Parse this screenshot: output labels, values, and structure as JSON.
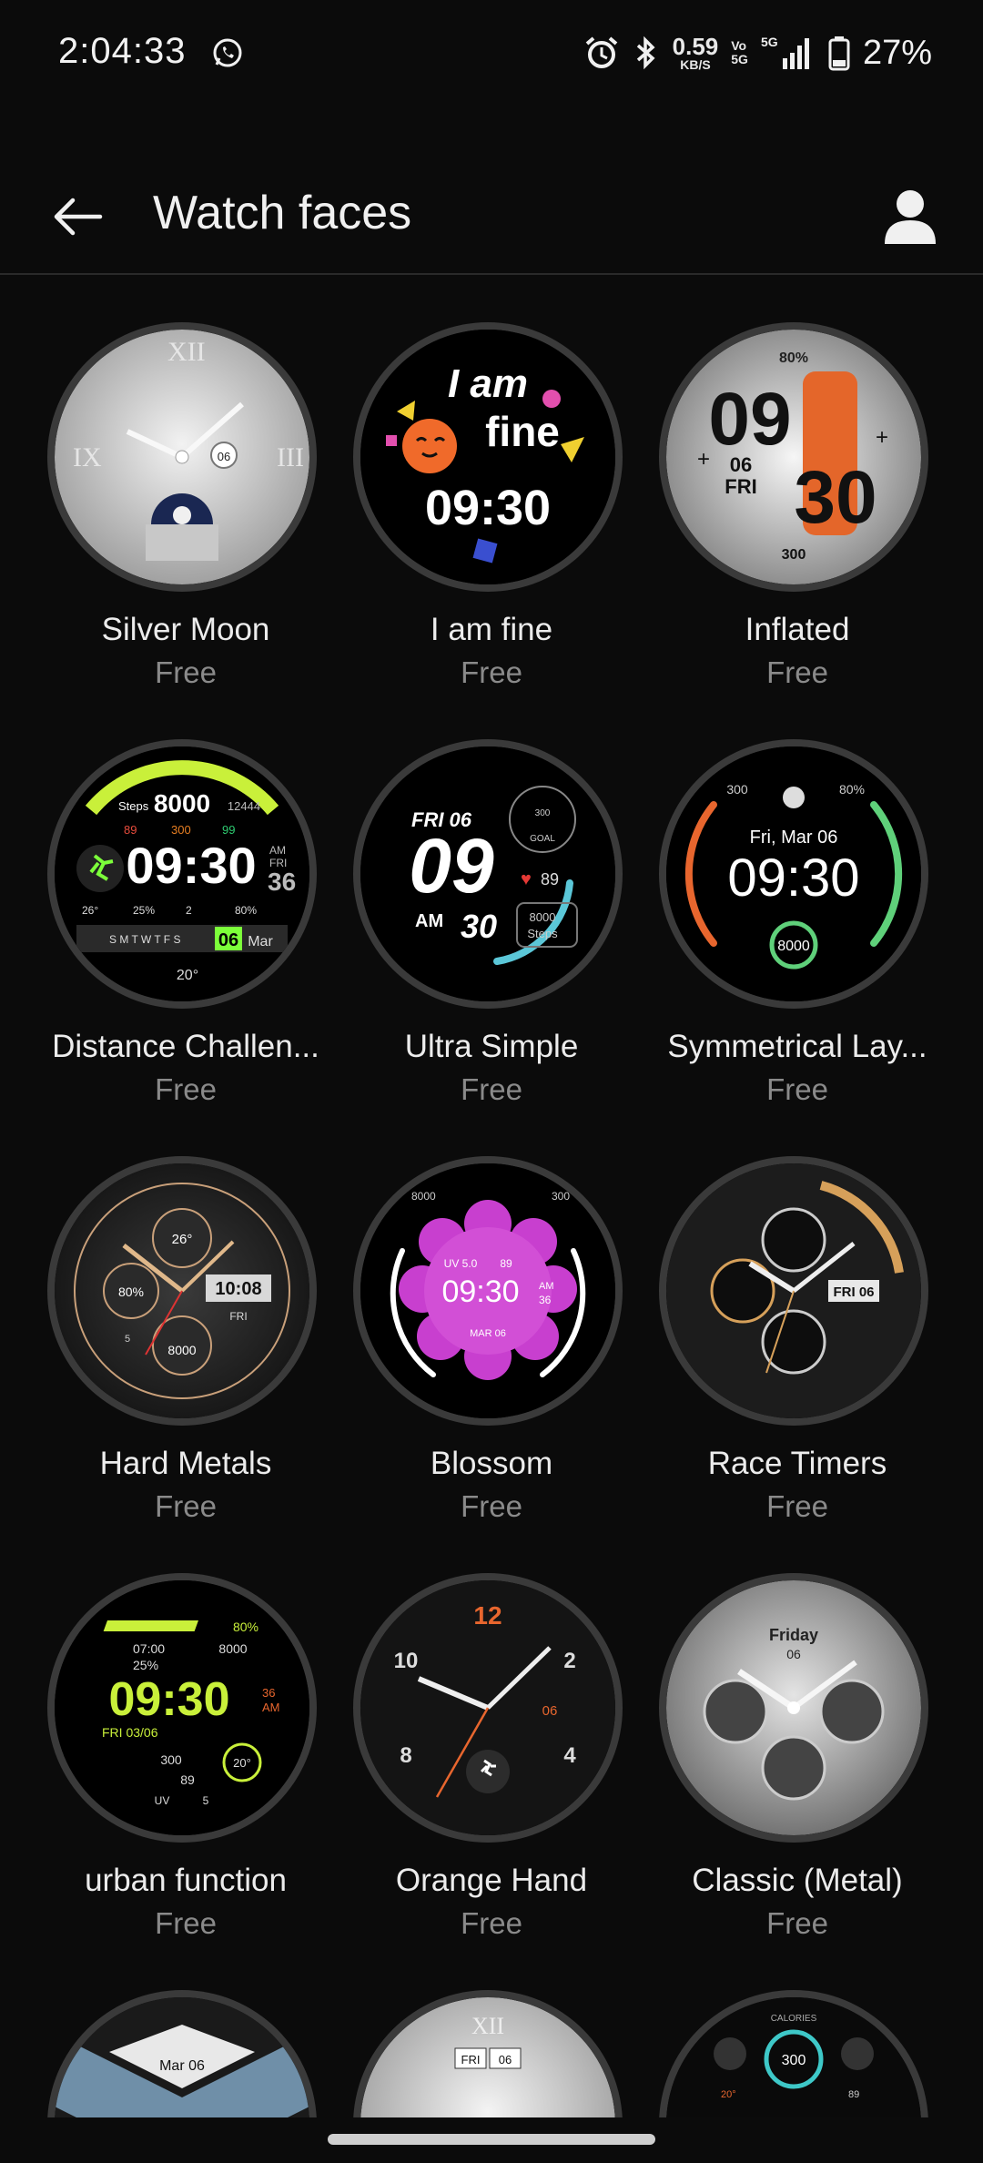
{
  "status_bar": {
    "time": "2:04:33",
    "net_speed_value": "0.59",
    "net_speed_unit": "KB/S",
    "volte_top": "Vo",
    "volte_bottom": "5G",
    "network_type": "5G",
    "battery": "27%",
    "icons": [
      "whatsapp-icon",
      "alarm-icon",
      "bluetooth-icon",
      "signal-icon",
      "battery-icon"
    ]
  },
  "header": {
    "title": "Watch faces",
    "back_icon": "arrow-left-icon",
    "profile_icon": "person-icon"
  },
  "watch_faces": [
    {
      "name": "Silver Moon",
      "price": "Free"
    },
    {
      "name": "I am fine",
      "price": "Free"
    },
    {
      "name": "Inflated",
      "price": "Free"
    },
    {
      "name": "Distance Challen...",
      "price": "Free"
    },
    {
      "name": "Ultra Simple",
      "price": "Free"
    },
    {
      "name": "Symmetrical Lay...",
      "price": "Free"
    },
    {
      "name": "Hard Metals",
      "price": "Free"
    },
    {
      "name": "Blossom",
      "price": "Free"
    },
    {
      "name": "Race Timers",
      "price": "Free"
    },
    {
      "name": "urban function",
      "price": "Free"
    },
    {
      "name": "Orange Hand",
      "price": "Free"
    },
    {
      "name": "Classic (Metal)",
      "price": "Free"
    },
    {
      "name": "",
      "price": ""
    },
    {
      "name": "",
      "price": ""
    },
    {
      "name": "",
      "price": ""
    }
  ],
  "face_text": {
    "silver_moon": {
      "date": "06"
    },
    "i_am_fine": {
      "line1": "I am",
      "line2": "fine",
      "time": "09:30"
    },
    "inflated": {
      "battery": "80%",
      "hour": "09",
      "minute": "30",
      "day": "06",
      "weekday": "FRI",
      "steps": "300"
    },
    "distance": {
      "steps_label": "Steps",
      "steps": "8000",
      "steps_goal": "12444",
      "hr": "89",
      "kcal": "300",
      "spo": "99",
      "time": "09:30",
      "ampm": "AM",
      "weekday": "FRI",
      "sec": "36",
      "weather": "26°",
      "humidity": "25%",
      "floors": "2",
      "battery": "80%",
      "days": "S M T W T F S",
      "date": "06",
      "month": "Mar",
      "temp": "20°"
    },
    "ultra_simple": {
      "date": "FRI 06",
      "hour": "09",
      "ampm": "AM",
      "minute": "30",
      "hr": "89",
      "steps": "8000",
      "steps_label": "Steps",
      "goal": "GOAL",
      "top": "300"
    },
    "symmetrical": {
      "left_top": "300",
      "right_top": "80%",
      "date": "Fri, Mar 06",
      "time": "09:30",
      "steps": "8000"
    },
    "hard_metals": {
      "temp": "26°",
      "battery": "80%",
      "time": "10:08",
      "weekday": "FRI",
      "steps": "8000",
      "uv": "5"
    },
    "blossom": {
      "steps": "8000",
      "kcal": "300",
      "uv": "UV 5.0",
      "hr": "89",
      "time": "09:30",
      "ampm": "AM",
      "sec": "36",
      "date": "MAR 06"
    },
    "race_timers": {
      "date": "FRI 06"
    },
    "urban_function": {
      "battery": "80%",
      "time_small": "07:00",
      "steps": "8000",
      "humidity": "25%",
      "time": "09:30",
      "sec": "36",
      "ampm": "AM",
      "date": "FRI 03/06",
      "kcal": "300",
      "temp": "20°",
      "hr": "89",
      "uv_label": "UV",
      "uv": "5"
    },
    "orange_hand": {
      "n12": "12",
      "n2": "2",
      "n4": "4",
      "n8": "8",
      "n10": "10",
      "date": "06"
    },
    "classic_metal": {
      "weekday": "Friday",
      "date": "06"
    },
    "partial_1": {
      "date": "Mar 06"
    },
    "partial_2": {
      "weekday": "FRI",
      "date": "06"
    },
    "partial_3": {
      "label": "CALORIES",
      "value": "300",
      "temp": "20°",
      "hr": "89"
    }
  },
  "colors": {
    "background": "#0b0b0b",
    "accent_orange": "#e8662e",
    "accent_green": "#5fd07a",
    "accent_lime": "#c9f03a",
    "accent_pink": "#d24fd6",
    "text_secondary": "#8a8a8a"
  }
}
